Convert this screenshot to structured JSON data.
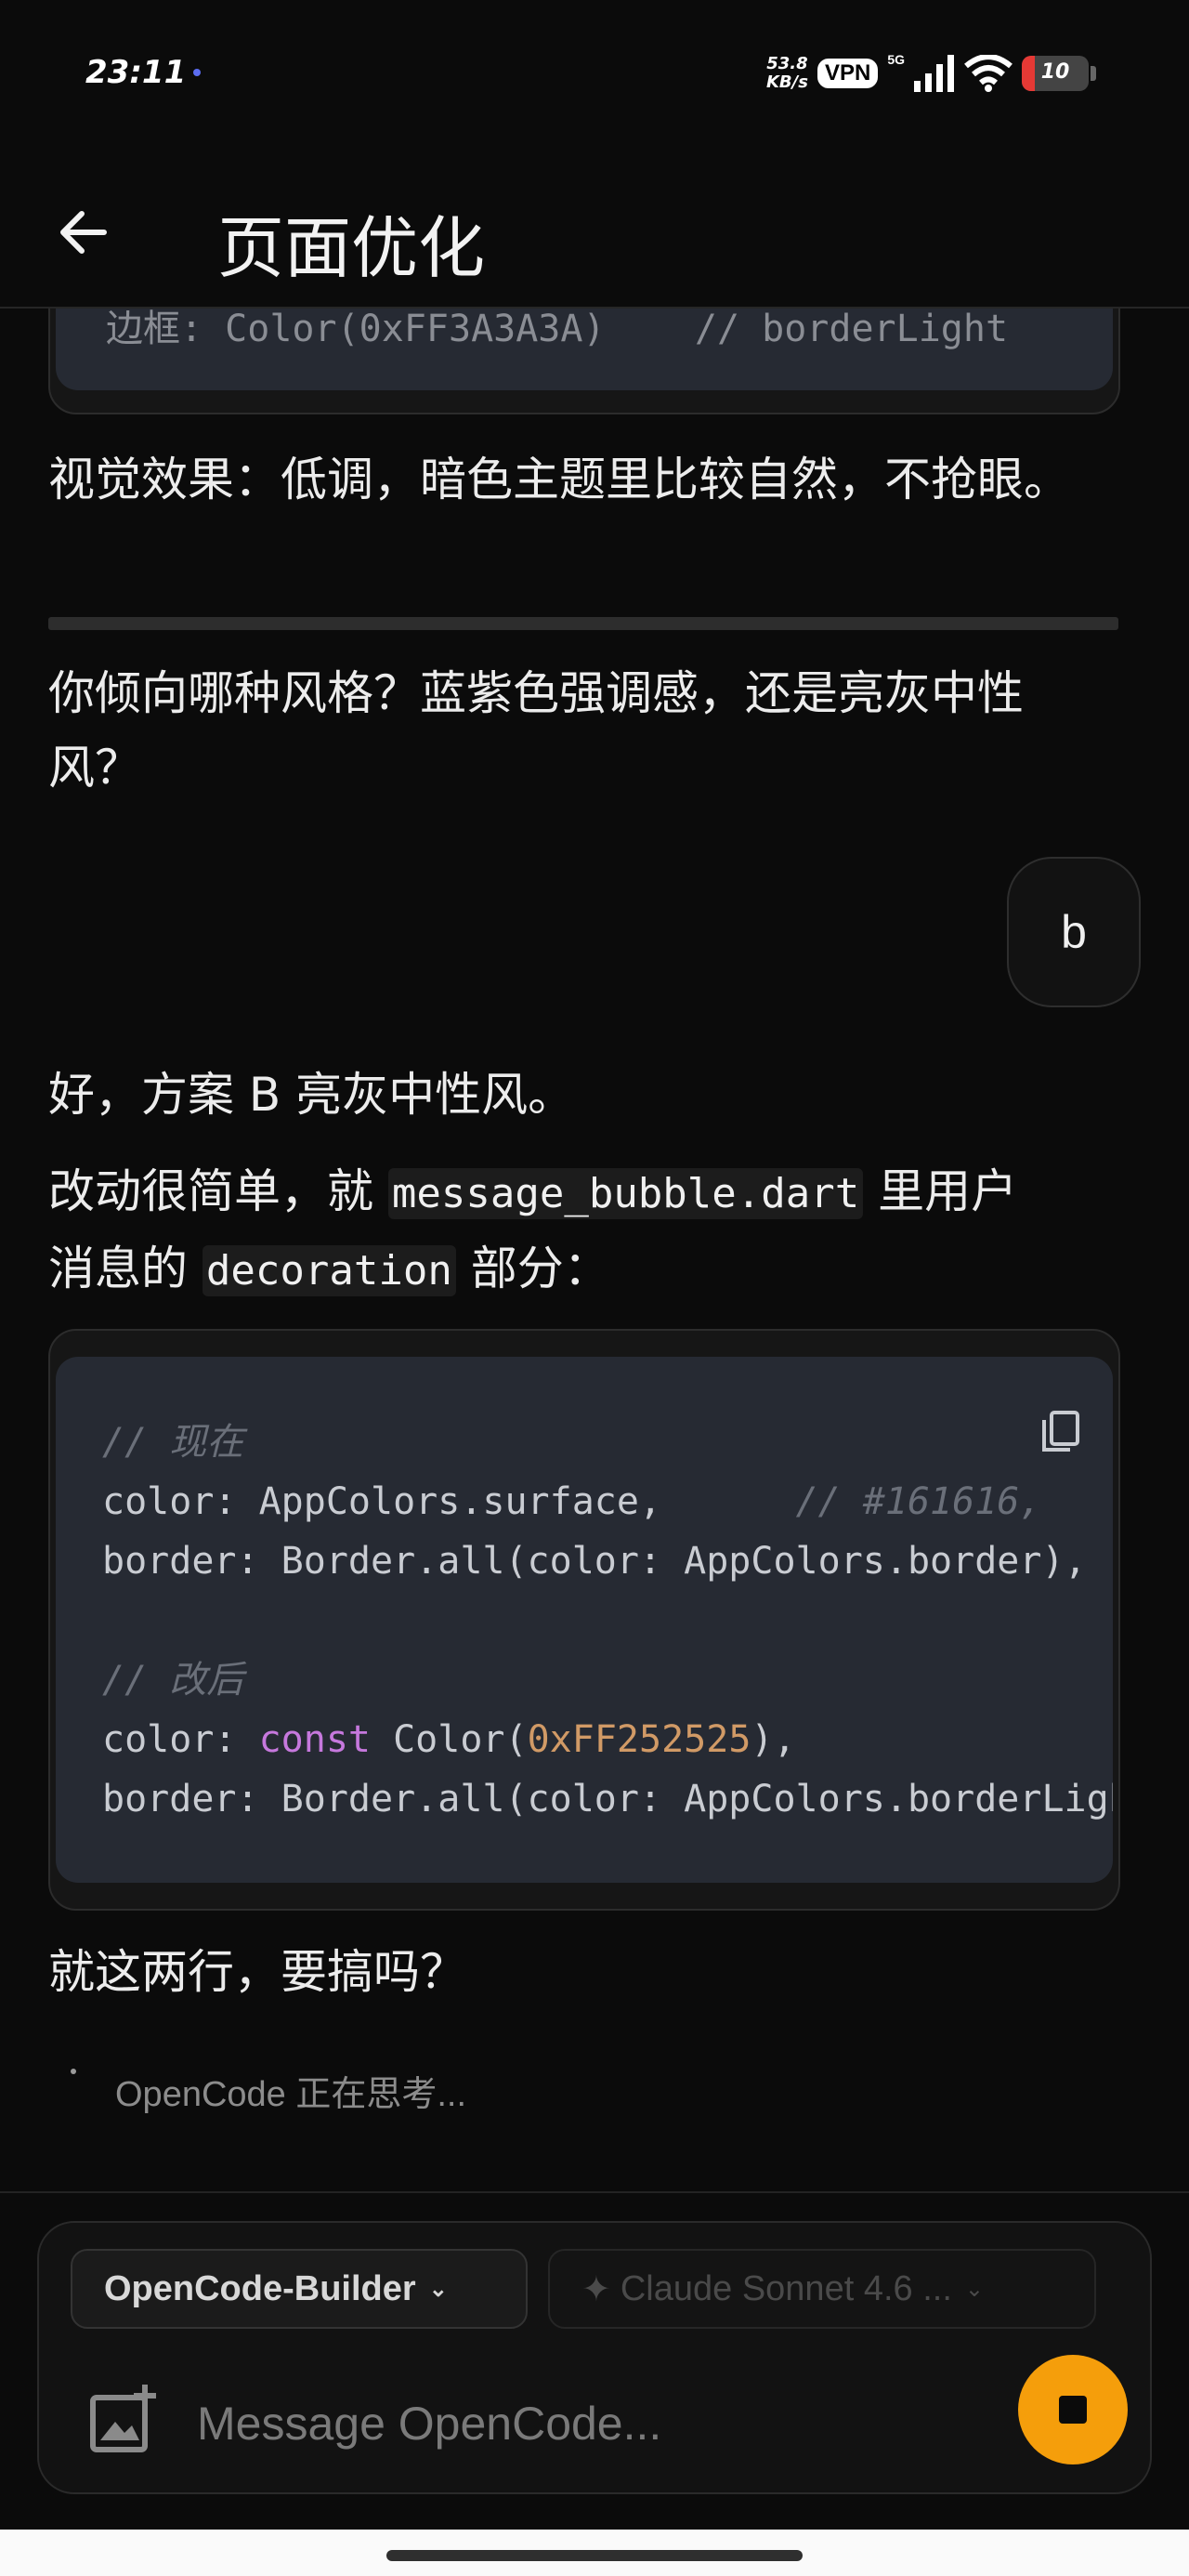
{
  "status_bar": {
    "time": "23:11",
    "net_speed_value": "53.8",
    "net_speed_unit": "KB/s",
    "vpn": "VPN",
    "network": "5G",
    "battery": "10",
    "battery_level": 0.1,
    "battery_color": "#e53935"
  },
  "app_bar": {
    "back_icon": "arrow-back-icon",
    "title": "页面优化"
  },
  "messages": {
    "top_code_partial": "边框: Color(0xFF3A3A3A)    // borderLight",
    "effect_text": "视觉效果：低调，暗色主题里比较自然，不抢眼。",
    "question_line1": "你倾向哪种风格？蓝紫色强调感，还是亮灰中性",
    "question_line2": "风？",
    "user_reply": "b",
    "ack": "好，方案 B 亮灰中性风。",
    "explain_line1_pre": "改动很简单，就 ",
    "explain_code1": "message_bubble.dart",
    "explain_line1_post": " 里用户",
    "explain_line2_pre": "消息的 ",
    "explain_code2": "decoration",
    "explain_line2_post": " 部分：",
    "code_block": {
      "comment_now": "// 现在",
      "line_color_now": "color: AppColors.surface,",
      "line_color_now_comment": "// #161616, ",
      "line_border_now": "border: Border.all(color: AppColors.border),",
      "comment_after": "// 改后",
      "line_color_after_pre": "color: ",
      "line_color_after_kw": "const",
      "line_color_after_mid": " Color(",
      "line_color_after_num": "0xFF252525",
      "line_color_after_post": "),",
      "line_border_after": "border: Border.all(color: AppColors.borderLight),"
    },
    "closing": "就这两行，要搞吗？"
  },
  "thinking": "OpenCode 正在思考...",
  "composer": {
    "agent_label": "OpenCode-Builder",
    "model_label": "Claude Sonnet 4.6 ...",
    "placeholder": "Message OpenCode...",
    "accent": "#f59e0b"
  },
  "colors": {
    "background": "#0b0b0b",
    "code_bg": "#262a33",
    "keyword": "#c678dd",
    "number": "#d19a66"
  }
}
